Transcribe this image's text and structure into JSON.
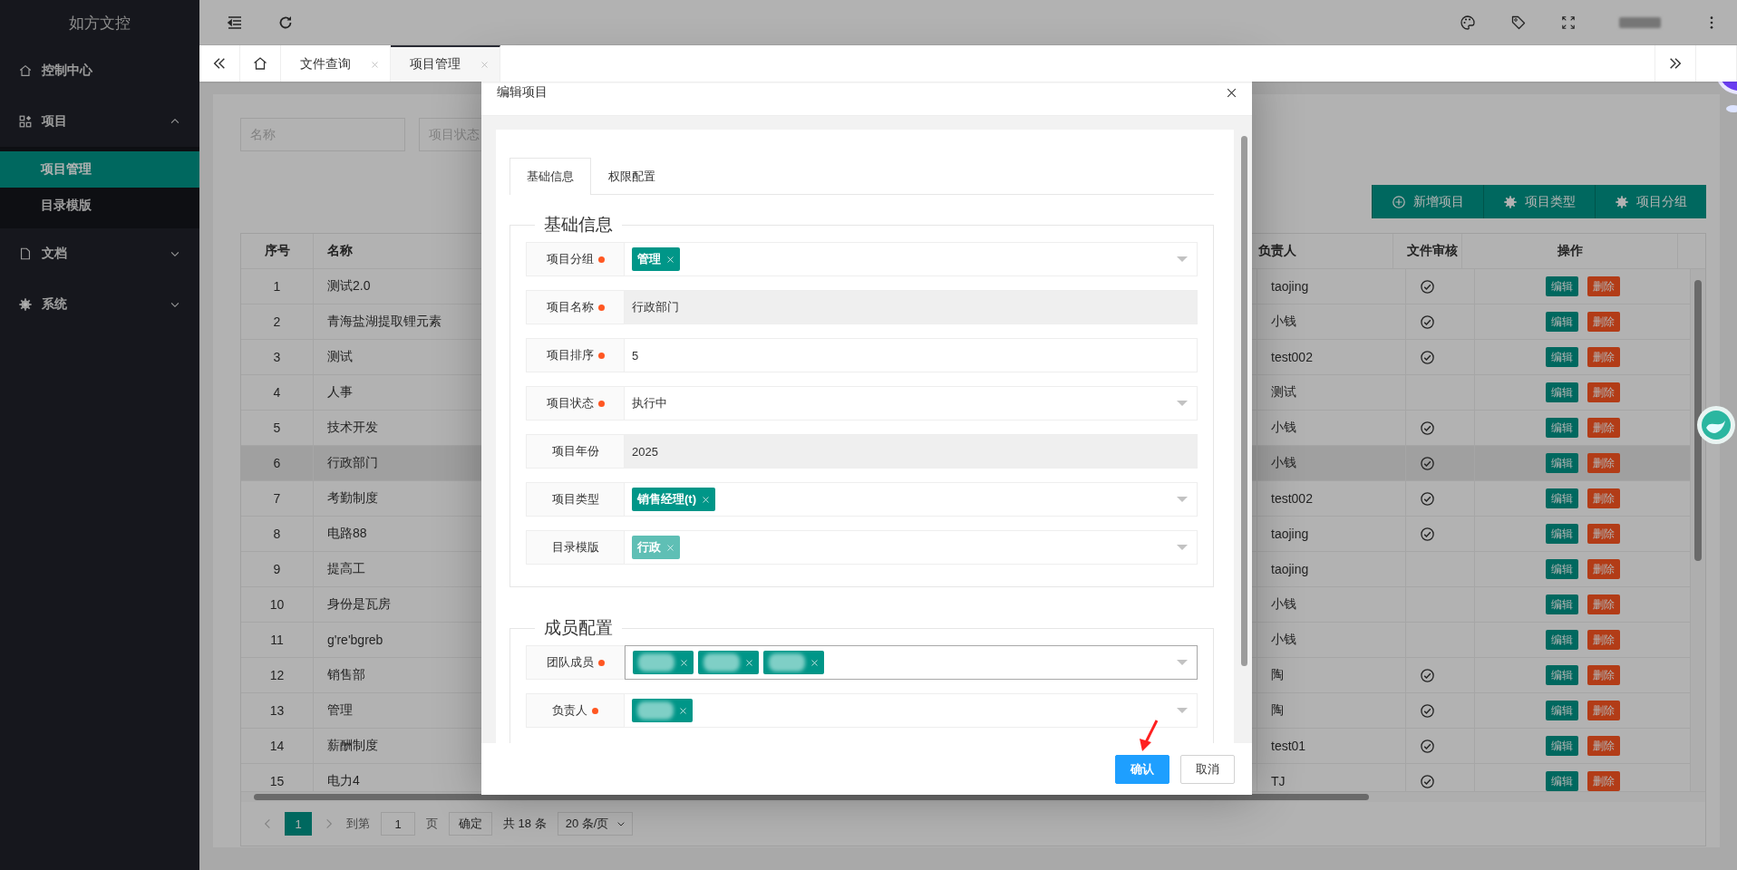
{
  "sidebar": {
    "logo": "如方文控",
    "items": [
      {
        "label": "控制中心"
      },
      {
        "label": "项目",
        "expanded": true,
        "children": [
          {
            "label": "项目管理",
            "selected": true
          },
          {
            "label": "目录模版",
            "selected": false
          }
        ]
      },
      {
        "label": "文档",
        "expanded": false
      },
      {
        "label": "系统",
        "expanded": false
      }
    ]
  },
  "tabs": [
    {
      "label": "文件查询",
      "selected": false
    },
    {
      "label": "项目管理",
      "selected": true
    }
  ],
  "filters": [
    {
      "placeholder": "名称"
    },
    {
      "placeholder": "项目状态"
    }
  ],
  "toolbar_buttons": [
    {
      "label": "新增项目"
    },
    {
      "label": "项目类型"
    },
    {
      "label": "项目分组"
    }
  ],
  "table": {
    "columns": [
      "序号",
      "名称",
      "负责人",
      "文件审核",
      "操作"
    ],
    "rows": [
      {
        "index": "1",
        "name": "测试2.0",
        "owner": "taojing",
        "reviewed": true,
        "selected": false,
        "edit": "编辑",
        "delete": "删除"
      },
      {
        "index": "2",
        "name": "青海盐湖提取锂元素",
        "owner": "小钱",
        "reviewed": true,
        "selected": false,
        "edit": "编辑",
        "delete": "删除"
      },
      {
        "index": "3",
        "name": "测试",
        "owner": "test002",
        "reviewed": true,
        "selected": false,
        "edit": "编辑",
        "delete": "删除"
      },
      {
        "index": "4",
        "name": "人事",
        "owner": "测试",
        "reviewed": false,
        "selected": false,
        "edit": "编辑",
        "delete": "删除"
      },
      {
        "index": "5",
        "name": "技术开发",
        "owner": "小钱",
        "reviewed": true,
        "selected": false,
        "edit": "编辑",
        "delete": "删除"
      },
      {
        "index": "6",
        "name": "行政部门",
        "owner": "小钱",
        "reviewed": true,
        "selected": true,
        "edit": "编辑",
        "delete": "删除"
      },
      {
        "index": "7",
        "name": "考勤制度",
        "owner": "test002",
        "reviewed": true,
        "selected": false,
        "edit": "编辑",
        "delete": "删除"
      },
      {
        "index": "8",
        "name": "电路88",
        "owner": "taojing",
        "reviewed": true,
        "selected": false,
        "edit": "编辑",
        "delete": "删除"
      },
      {
        "index": "9",
        "name": "提高工",
        "owner": "taojing",
        "reviewed": false,
        "selected": false,
        "edit": "编辑",
        "delete": "删除"
      },
      {
        "index": "10",
        "name": "身份是瓦房",
        "owner": "小钱",
        "reviewed": false,
        "selected": false,
        "edit": "编辑",
        "delete": "删除"
      },
      {
        "index": "11",
        "name": "g're'bgreb",
        "owner": "小钱",
        "reviewed": false,
        "selected": false,
        "edit": "编辑",
        "delete": "删除"
      },
      {
        "index": "12",
        "name": "销售部",
        "owner": "陶",
        "reviewed": true,
        "selected": false,
        "edit": "编辑",
        "delete": "删除"
      },
      {
        "index": "13",
        "name": "管理",
        "owner": "陶",
        "reviewed": true,
        "selected": false,
        "edit": "编辑",
        "delete": "删除"
      },
      {
        "index": "14",
        "name": "薪酬制度",
        "owner": "test01",
        "reviewed": true,
        "selected": false,
        "edit": "编辑",
        "delete": "删除"
      },
      {
        "index": "15",
        "name": "电力4",
        "owner": "TJ",
        "reviewed": true,
        "selected": false,
        "edit": "编辑",
        "delete": "删除"
      }
    ]
  },
  "pagination": {
    "pages": [
      {
        "label": "1",
        "selected": true
      }
    ],
    "goto_label": "到第",
    "goto_value": "1",
    "page_label": "页",
    "confirm": "确定",
    "total": "共 18 条",
    "page_size": "20 条/页"
  },
  "dialog": {
    "title": "编辑项目",
    "tabs": [
      {
        "label": "基础信息",
        "selected": true
      },
      {
        "label": "权限配置",
        "selected": false
      }
    ],
    "sections": [
      {
        "legend": "基础信息",
        "fields": [
          {
            "label": "项目分组",
            "required": true,
            "focused": false,
            "kind": "tags",
            "tags": [
              {
                "kind": "text",
                "text": "管理",
                "disabled": false
              }
            ]
          },
          {
            "label": "项目名称",
            "required": true,
            "focused": false,
            "kind": "input",
            "readonly": true,
            "value": "行政部门"
          },
          {
            "label": "项目排序",
            "required": true,
            "focused": false,
            "kind": "input",
            "readonly": false,
            "value": "5"
          },
          {
            "label": "项目状态",
            "required": true,
            "focused": false,
            "kind": "select",
            "value": "执行中"
          },
          {
            "label": "项目年份",
            "required": false,
            "focused": false,
            "kind": "input",
            "readonly": true,
            "value": "2025"
          },
          {
            "label": "项目类型",
            "required": false,
            "focused": false,
            "kind": "tags",
            "tags": [
              {
                "kind": "text",
                "text": "销售经理(t)",
                "disabled": false
              }
            ]
          },
          {
            "label": "目录模版",
            "required": false,
            "focused": false,
            "kind": "tags",
            "tags": [
              {
                "kind": "text",
                "text": "行政",
                "disabled": true
              }
            ]
          }
        ]
      },
      {
        "legend": "成员配置",
        "fields": [
          {
            "label": "团队成员",
            "required": true,
            "focused": true,
            "kind": "tags",
            "tags": [
              {
                "kind": "redacted",
                "disabled": false
              },
              {
                "kind": "redacted",
                "disabled": false
              },
              {
                "kind": "redacted",
                "disabled": false
              }
            ]
          },
          {
            "label": "负责人",
            "required": true,
            "focused": false,
            "kind": "tags",
            "tags": [
              {
                "kind": "redacted",
                "disabled": false
              }
            ]
          }
        ]
      }
    ],
    "buttons": [
      {
        "label": "确认",
        "primary": true
      },
      {
        "label": "取消",
        "primary": false
      }
    ]
  }
}
